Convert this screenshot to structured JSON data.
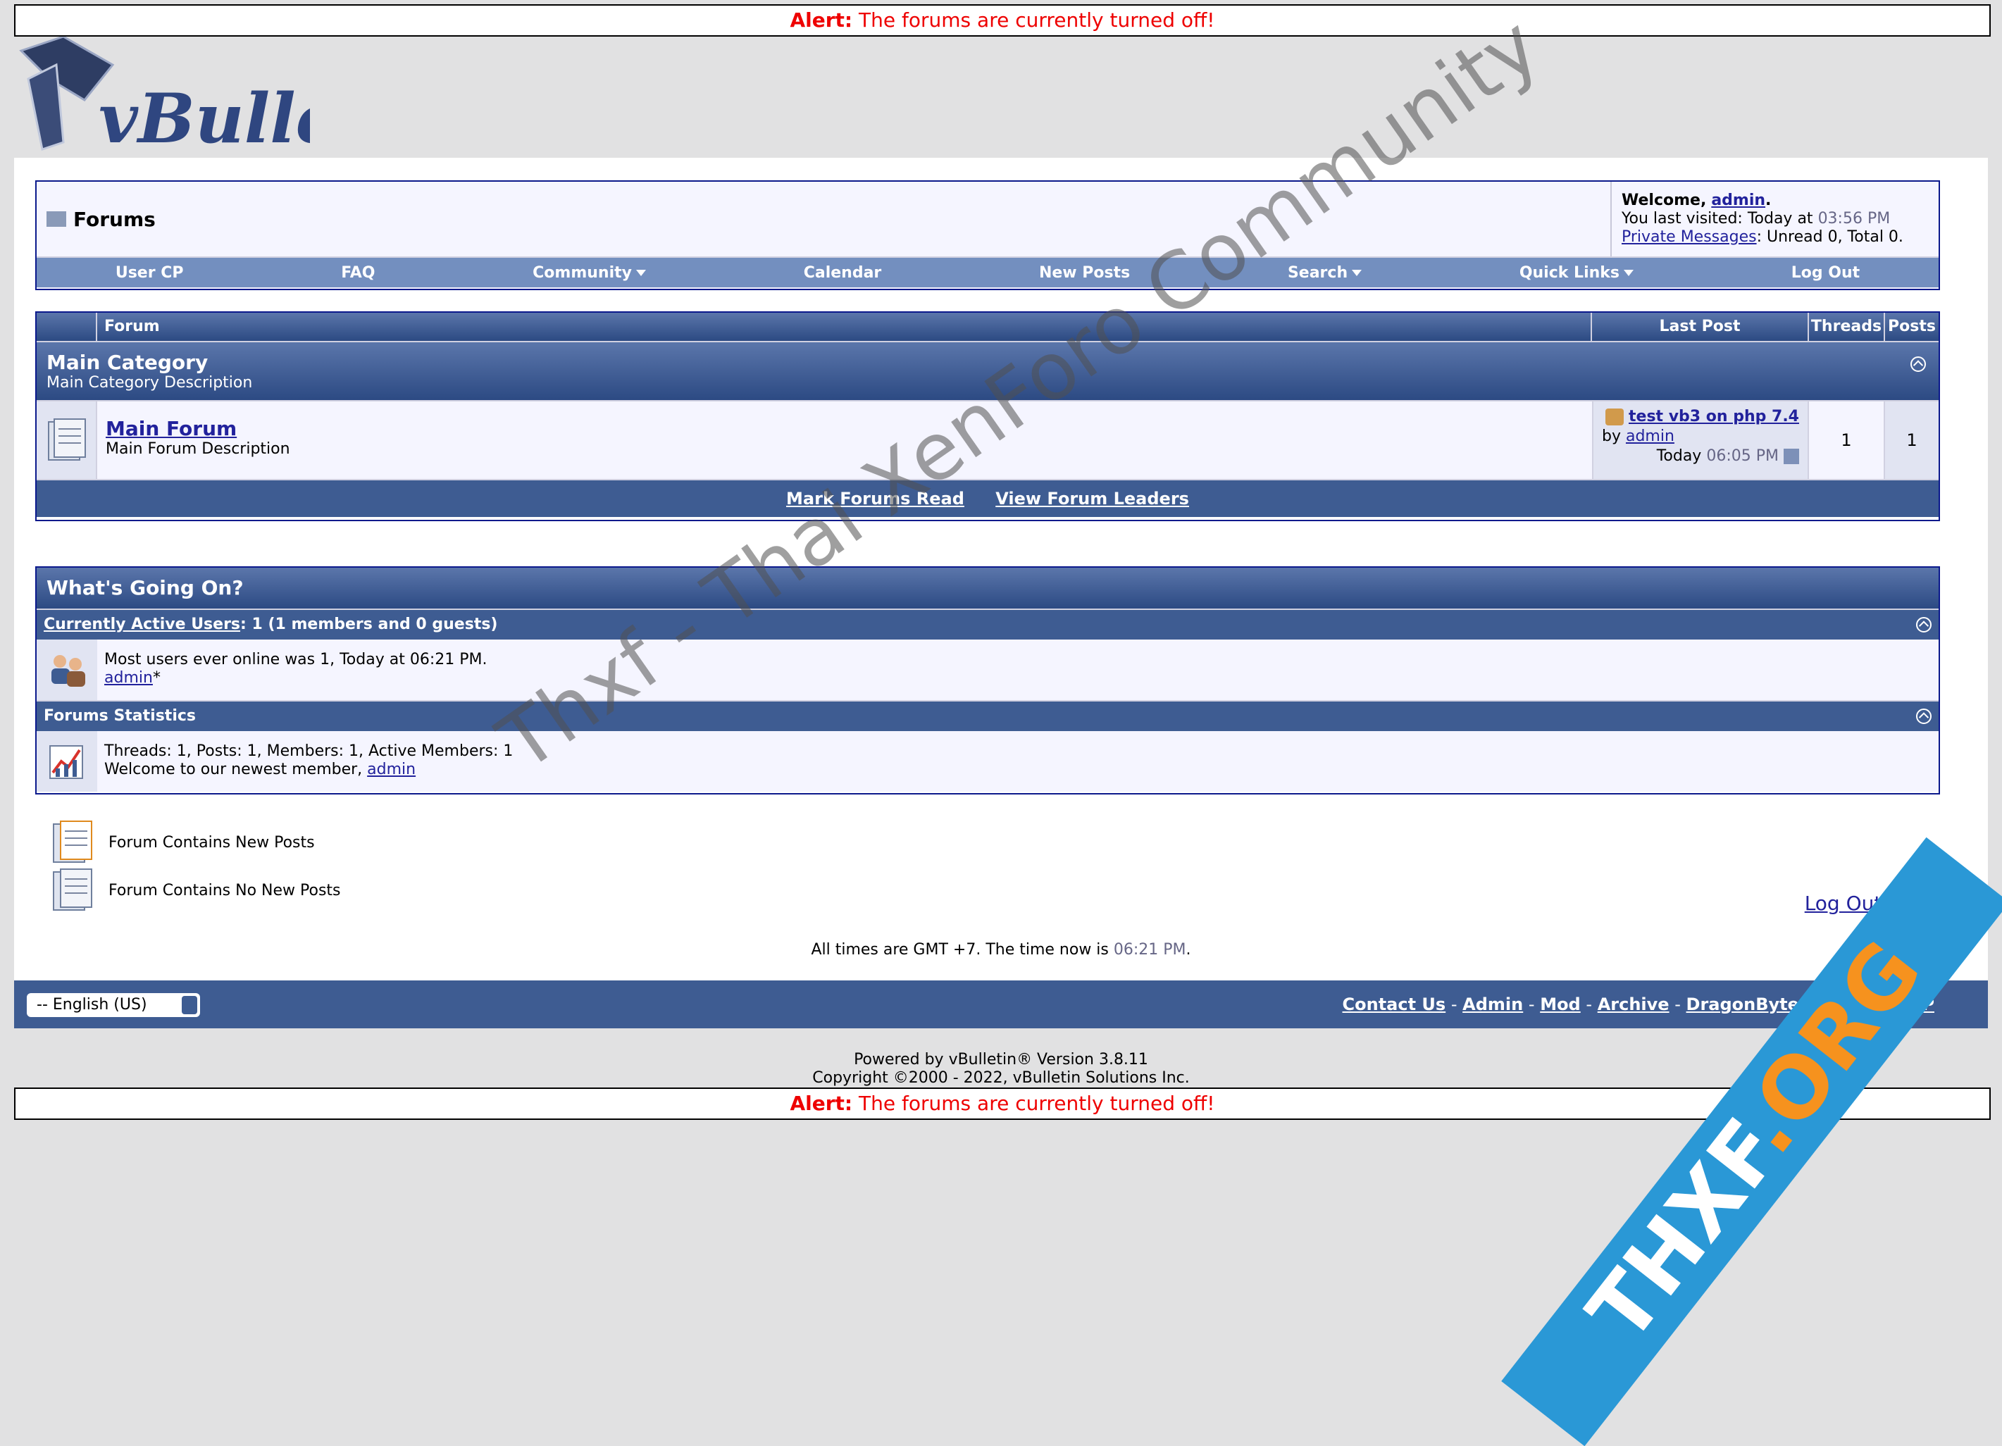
{
  "alert": {
    "label": "Alert:",
    "message": "The forums are currently turned off!"
  },
  "logo": {
    "text": "vBulletin",
    "registered": "®"
  },
  "navbar": {
    "title": "Forums",
    "welcome_prefix": "Welcome,",
    "welcome_user": "admin",
    "welcome_suffix": ".",
    "last_visited_prefix": "You last visited: Today at",
    "last_visited_time": "03:56 PM",
    "pm_link": "Private Messages",
    "pm_status": ": Unread 0, Total 0.",
    "menu": [
      "User CP",
      "FAQ",
      "Community",
      "Calendar",
      "New Posts",
      "Search",
      "Quick Links",
      "Log Out"
    ]
  },
  "forum_table": {
    "headers": {
      "forum": "Forum",
      "last_post": "Last Post",
      "threads": "Threads",
      "posts": "Posts"
    },
    "category": {
      "title": "Main Category",
      "description": "Main Category Description"
    },
    "forum": {
      "title": "Main Forum",
      "description": "Main Forum Description",
      "last_post_title": "test vb3 on php 7.4",
      "last_post_by": "by",
      "last_post_user": "admin",
      "last_post_day": "Today",
      "last_post_time": "06:05 PM",
      "threads": "1",
      "posts": "1"
    },
    "footer": {
      "mark_read": "Mark Forums Read",
      "view_leaders": "View Forum Leaders"
    }
  },
  "whats_going_on": {
    "title": "What's Going On?",
    "active_users": {
      "link": "Currently Active Users",
      "summary": ": 1 (1 members and 0 guests)",
      "record": "Most users ever online was 1, Today at 06:21 PM.",
      "user": "admin",
      "user_suffix": "*"
    },
    "stats": {
      "title": "Forums Statistics",
      "line1": "Threads: 1, Posts: 1, Members: 1, Active Members: 1",
      "line2_prefix": "Welcome to our newest member,",
      "newest_member": "admin"
    }
  },
  "legend": {
    "new_posts": "Forum Contains New Posts",
    "no_new_posts": "Forum Contains No New Posts"
  },
  "logout_link": "Log Out admin",
  "timezone": {
    "prefix": "All times are GMT +7. The time now is",
    "time": "06:21 PM",
    "suffix": "."
  },
  "footer": {
    "language": "-- English (US)",
    "links": [
      "Contact Us",
      "Admin",
      "Mod",
      "Archive",
      "DragonByte SEO AdminCP"
    ],
    "separator": "-"
  },
  "copyright": {
    "line1": "Powered by vBulletin® Version 3.8.11",
    "line2": "Copyright ©2000 - 2022, vBulletin Solutions Inc."
  },
  "watermark": "Thxf - Thai XenForo Community",
  "badge": {
    "part1": "THXF",
    "part2": ".ORG"
  },
  "colors": {
    "accent": "#3e5c92",
    "link": "#22229c",
    "alert": "#ee0000",
    "badge": "#2a98d6"
  }
}
